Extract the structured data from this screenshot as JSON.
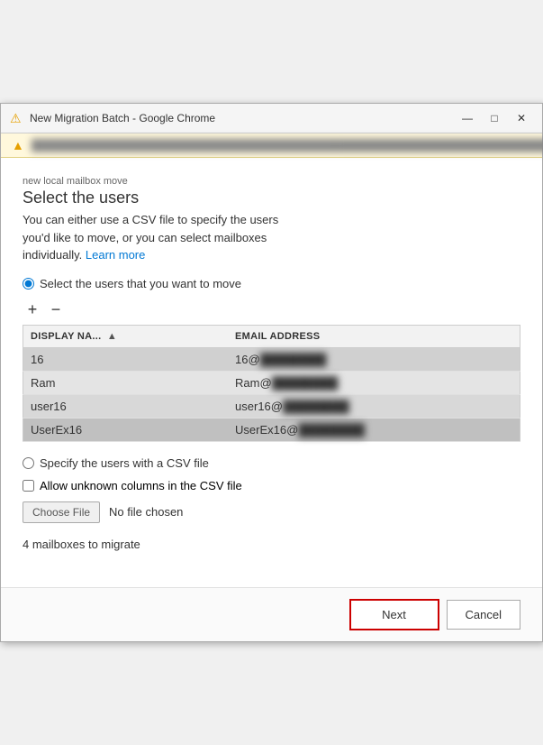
{
  "window": {
    "title": "New Migration Batch - Google Chrome",
    "icon": "⚠"
  },
  "title_bar": {
    "minimize_label": "—",
    "maximize_label": "□",
    "close_label": "✕"
  },
  "warning_bar": {
    "text": "                                                                        "
  },
  "page": {
    "subtitle": "new local mailbox move",
    "title": "Select the users",
    "description_1": "You can either use a CSV file to specify the users",
    "description_2": "you'd like to move, or you can select mailboxes",
    "description_3": "individually.",
    "learn_more": "Learn more"
  },
  "options": {
    "select_users_label": "Select the users that you want to move",
    "csv_label": "Specify the users with a CSV file",
    "unknown_columns_label": "Allow unknown columns in the CSV file",
    "no_file_label": "No file chosen",
    "choose_file_label": "Choose File",
    "mailbox_count": "4 mailboxes to migrate"
  },
  "table": {
    "col1_header": "DISPLAY NA...",
    "col2_header": "EMAIL ADDRESS",
    "rows": [
      {
        "name": "16",
        "email_prefix": "16@",
        "email_domain": "██████████"
      },
      {
        "name": "Ram",
        "email_prefix": "Ram@",
        "email_domain": "████████"
      },
      {
        "name": "user16",
        "email_prefix": "user16@",
        "email_domain": "████████"
      },
      {
        "name": "UserEx16",
        "email_prefix": "UserEx16@",
        "email_domain": "███████"
      }
    ]
  },
  "toolbar": {
    "add_label": "+",
    "remove_label": "−"
  },
  "footer": {
    "next_label": "Next",
    "cancel_label": "Cancel"
  }
}
